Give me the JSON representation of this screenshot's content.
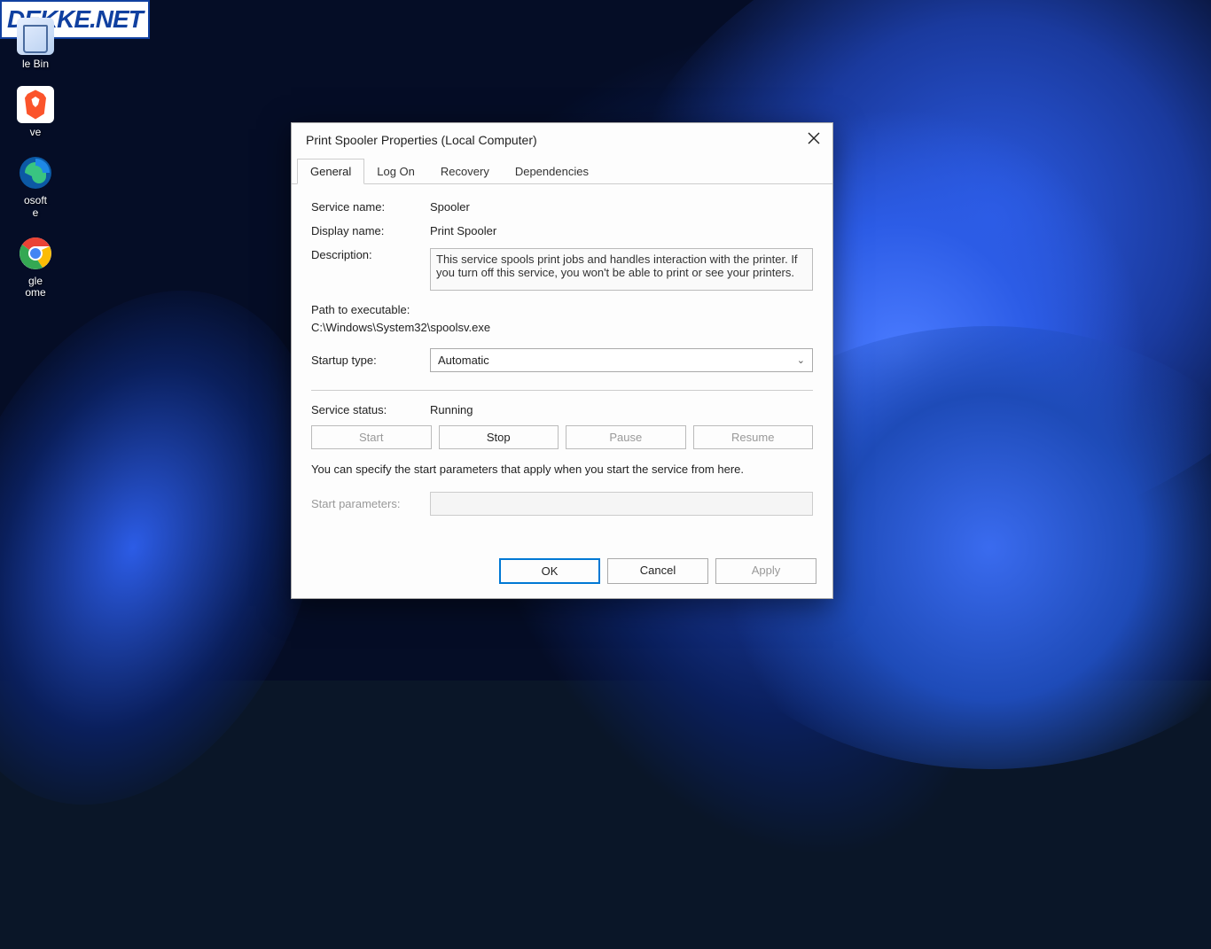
{
  "watermark": "DEKKE.NET",
  "desktop_icons": {
    "recycle": "le Bin",
    "brave": "ve",
    "edge_line1": "osoft",
    "edge_line2": "e",
    "chrome_line1": "gle",
    "chrome_line2": "ome"
  },
  "dialog": {
    "title": "Print Spooler Properties (Local Computer)",
    "tabs": [
      "General",
      "Log On",
      "Recovery",
      "Dependencies"
    ],
    "fields": {
      "service_name_label": "Service name:",
      "service_name_value": "Spooler",
      "display_name_label": "Display name:",
      "display_name_value": "Print Spooler",
      "description_label": "Description:",
      "description_value": "This service spools print jobs and handles interaction with the printer.  If you turn off this service, you won't be able to print or see your printers.",
      "path_label": "Path to executable:",
      "path_value": "C:\\Windows\\System32\\spoolsv.exe",
      "startup_label": "Startup type:",
      "startup_value": "Automatic",
      "status_label": "Service status:",
      "status_value": "Running"
    },
    "service_buttons": {
      "start": "Start",
      "stop": "Stop",
      "pause": "Pause",
      "resume": "Resume"
    },
    "help_text": "You can specify the start parameters that apply when you start the service from here.",
    "params_label": "Start parameters:",
    "params_value": "",
    "buttons": {
      "ok": "OK",
      "cancel": "Cancel",
      "apply": "Apply"
    }
  }
}
